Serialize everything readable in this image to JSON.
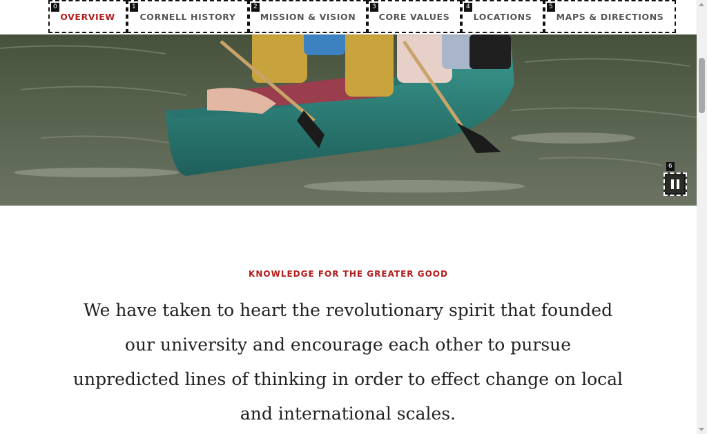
{
  "subnav": {
    "tabs": [
      {
        "index": "0",
        "label": "OVERVIEW",
        "active": true
      },
      {
        "index": "1",
        "label": "CORNELL HISTORY"
      },
      {
        "index": "2",
        "label": "MISSION & VISION"
      },
      {
        "index": "3",
        "label": "CORE VALUES"
      },
      {
        "index": "4",
        "label": "LOCATIONS"
      },
      {
        "index": "5",
        "label": "MAPS & DIRECTIONS"
      }
    ]
  },
  "hero": {
    "pause_index": "6",
    "pause_icon": "pause-icon"
  },
  "content": {
    "eyebrow": "KNOWLEDGE FOR THE GREATER GOOD",
    "lead": "We have taken to heart the revolutionary spirit that founded our university and encourage each other to pursue unpredicted lines of thinking in order to effect change on local and international scales."
  },
  "colors": {
    "accent": "#b31b1b",
    "text": "#222222",
    "tab_text": "#555555"
  }
}
